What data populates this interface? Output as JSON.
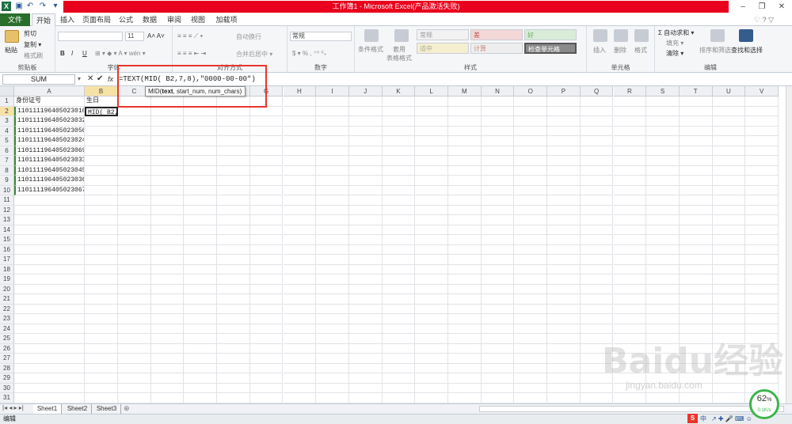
{
  "window": {
    "title": "工作簿1 - Microsoft Excel(产品激活失败)"
  },
  "tabs": [
    "文件",
    "开始",
    "插入",
    "页面布局",
    "公式",
    "数据",
    "审阅",
    "视图",
    "加载项"
  ],
  "ribbon": {
    "clipboard": {
      "paste": "粘贴",
      "cut": "剪切",
      "copy": "复制 ▾",
      "format_painter": "格式刷",
      "label": "剪贴板"
    },
    "font": {
      "size": "11",
      "bold": "B",
      "italic": "I",
      "underline": "U",
      "label": "字体"
    },
    "alignment": {
      "wrap": "自动换行",
      "merge": "合并后居中 ▾",
      "label": "对齐方式"
    },
    "number": {
      "format": "常规",
      "label": "数字"
    },
    "styles": {
      "conditional": "条件格式",
      "table": "套用\n表格格式",
      "normal": "常规",
      "bad": "差",
      "good": "好",
      "neutral": "适中",
      "calc": "计算",
      "check": "检查单元格",
      "label": "样式"
    },
    "cells": {
      "insert": "插入",
      "delete": "删除",
      "format": "格式",
      "label": "单元格"
    },
    "editing": {
      "autosum": "Σ 自动求和 ▾",
      "fill": "填充 ▾",
      "clear": "清除 ▾",
      "sort": "排序和筛选",
      "find": "查找和选择",
      "label": "编辑"
    }
  },
  "formula_bar": {
    "name_box": "SUM",
    "fx": "fx",
    "formula": "=TEXT(MID( B2,7,8),\"0000-00-00\")",
    "tooltip": "MID(text, start_num, num_chars)"
  },
  "columns": [
    "A",
    "B",
    "C",
    "D",
    "E",
    "F",
    "G",
    "H",
    "I",
    "J",
    "K",
    "L",
    "M",
    "N",
    "O",
    "P",
    "Q",
    "R",
    "S",
    "T",
    "U",
    "V"
  ],
  "rows": [
    "1",
    "2",
    "3",
    "4",
    "5",
    "6",
    "7",
    "8",
    "9",
    "10",
    "11",
    "12",
    "13",
    "14",
    "15",
    "16",
    "17",
    "18",
    "19",
    "20",
    "21",
    "22",
    "23",
    "24",
    "25",
    "26",
    "27",
    "28",
    "29",
    "30",
    "31"
  ],
  "cells": {
    "a": [
      "身份证号",
      "110111196405023010",
      "110111196405023032",
      "110111196405023056",
      "110111196405023024",
      "110111196405023069",
      "110111196405023033",
      "110111196405023045",
      "110111196405023036",
      "110111196405023067"
    ],
    "b1": "生日",
    "b2": "MID( B2,"
  },
  "sheets": [
    "Sheet1",
    "Sheet2",
    "Sheet3"
  ],
  "status": {
    "mode": "编辑",
    "gauge_percent": "62",
    "gauge_unit": "%",
    "gauge_speed": "0.1K/s",
    "ime": "中"
  },
  "watermark": {
    "main": "Baidu经验",
    "sub": "jingyan.baidu.com"
  },
  "colors": {
    "accent": "#2a6e2c",
    "title_red": "#e8001c",
    "highlight_box": "#e8362c",
    "gauge": "#3bb54a"
  }
}
